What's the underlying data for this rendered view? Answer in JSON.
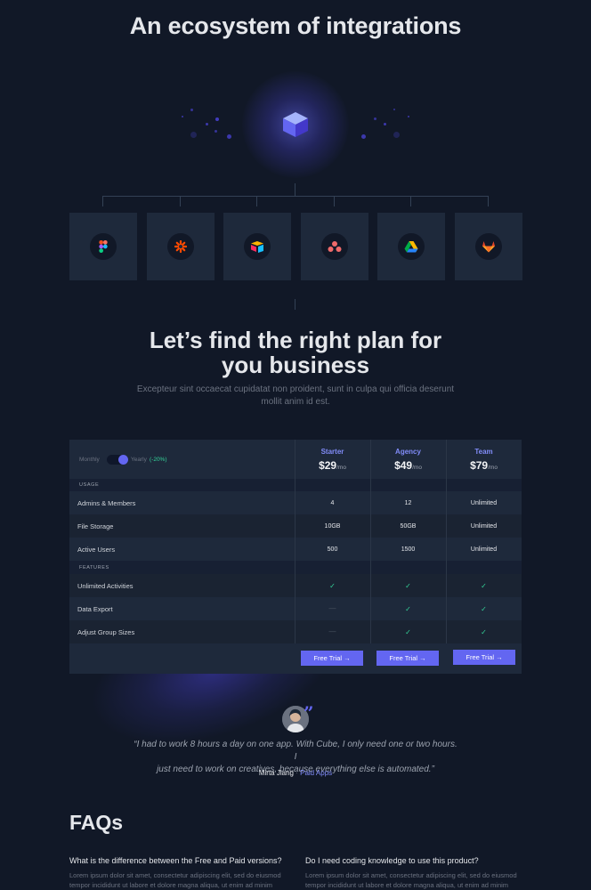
{
  "integrations": {
    "title": "An ecosystem of integrations",
    "apps": [
      {
        "icon": "figma-icon"
      },
      {
        "icon": "zapier-icon"
      },
      {
        "icon": "airtable-icon"
      },
      {
        "icon": "asana-icon"
      },
      {
        "icon": "google-drive-icon"
      },
      {
        "icon": "gitlab-icon"
      }
    ],
    "hub_icon": "cube-icon"
  },
  "pricing": {
    "title_line1": "Let’s find the right plan for",
    "title_line2": "you business",
    "lead_line1": "Excepteur sint occaecat cupidatat non proident, sunt in culpa qui officia deserunt",
    "lead_line2": "mollit anim id est.",
    "toggle": {
      "monthly": "Monthly",
      "yearly": "Yearly",
      "discount": "(-20%)"
    },
    "plans": [
      {
        "name": "Starter",
        "price": "$29",
        "period": "/mo",
        "cta": "Free Trial →"
      },
      {
        "name": "Agency",
        "price": "$49",
        "period": "/mo",
        "cta": "Free Trial →"
      },
      {
        "name": "Team",
        "price": "$79",
        "period": "/mo",
        "cta": "Free Trial →"
      }
    ],
    "sections": {
      "usage": "USAGE",
      "features": "FEATURES"
    },
    "usage_rows": [
      {
        "label": "Admins & Members",
        "values": [
          "4",
          "12",
          "Unlimited"
        ]
      },
      {
        "label": "File Storage",
        "values": [
          "10GB",
          "50GB",
          "Unlimited"
        ]
      },
      {
        "label": "Active Users",
        "values": [
          "500",
          "1500",
          "Unlimited"
        ]
      }
    ],
    "feature_rows": [
      {
        "label": "Unlimited Activities",
        "values": [
          "check",
          "check",
          "check"
        ]
      },
      {
        "label": "Data Export",
        "values": [
          "dash",
          "check",
          "check"
        ]
      },
      {
        "label": "Adjust Group Sizes",
        "values": [
          "dash",
          "check",
          "check"
        ]
      }
    ],
    "check_glyph": "✓",
    "dash_glyph": "—"
  },
  "testimonial": {
    "quote_line1": "“I had to work 8 hours a day on one app. With Cube, I only need one or two hours. I",
    "quote_line2": "just need to work on creatives, because everything else is automated.”",
    "author": "Mirta Jiang",
    "separator": "·",
    "role": "Paid Apps",
    "quote_mark": "”"
  },
  "faq": {
    "title": "FAQs",
    "items": [
      {
        "question": "What is the difference between the Free and Paid versions?",
        "answer_line1": "Lorem ipsum dolor sit amet, consectetur adipiscing elit, sed do eiusmod",
        "answer_line2": "tempor incididunt ut labore et dolore magna aliqua, ut enim ad minim"
      },
      {
        "question": "Do I need coding knowledge to use this product?",
        "answer_line1": "Lorem ipsum dolor sit amet, consectetur adipiscing elit, sed do eiusmod",
        "answer_line2": "tempor incididunt ut labore et dolore magna aliqua, ut enim ad minim"
      }
    ]
  },
  "colors": {
    "background": "#111827",
    "card": "#1e293b",
    "accent": "#6366f1",
    "accent_text": "#818cf8",
    "check": "#34d399",
    "discount": "#34d399"
  }
}
